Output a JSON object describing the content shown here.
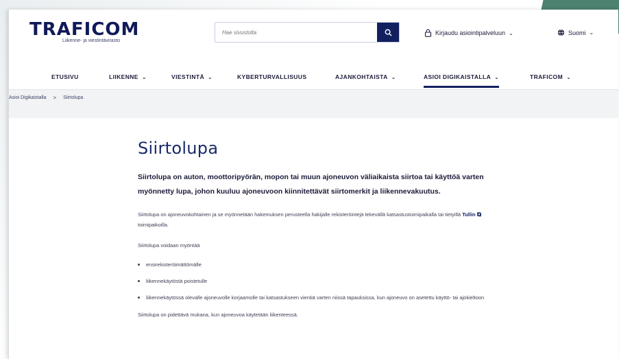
{
  "logo": {
    "wordmark": "TRAFICOM",
    "subtitle": "Liikenne- ja viestintävirasto"
  },
  "search": {
    "placeholder": "Hae sivustolta"
  },
  "header": {
    "login_label": "Kirjaudu asiointipalveluun",
    "language_label": "Suomi"
  },
  "nav": {
    "items": [
      {
        "label": "ETUSIVU"
      },
      {
        "label": "LIIKENNE"
      },
      {
        "label": "VIESTINTÄ"
      },
      {
        "label": "KYBERTURVALLISUUS"
      },
      {
        "label": "AJANKOHTAISTA"
      },
      {
        "label": "ASIOI DIGIKAISTALLA"
      },
      {
        "label": "TRAFICOM"
      }
    ]
  },
  "breadcrumb": {
    "items": [
      "Asioi Digikaistalla",
      "Siirtolupa"
    ],
    "separator": ">"
  },
  "main": {
    "title": "Siirtolupa",
    "lead": "Siirtolupa on auton, moottoripyörän, mopon tai muun ajoneuvon väliaikaista siirtoa tai käyttöä varten myönnetty lupa, johon kuuluu ajoneuvoon kiinnitettävät siirtomerkit ja liikennevakuutus.",
    "para1_before": "Siirtolupa on ajoneuvokohtainen ja se myönnetään hakemuksen perusteella hakijalle rekisteröintejä tekevällä katsastustoimipaikalla tai tietyillä",
    "para1_link": "Tullin",
    "para1_after": "toimipaikoilla.",
    "para2": "Siirtolupa voidaan myöntää",
    "list": [
      "ensirekisteröimättömälle",
      "liikennekäytöstä poistetulle",
      "liikennekäytössä olevalle ajoneuvolle korjaamolle tai katsastukseen vientiä varten niissä tapauksissa, kun ajoneuvo on asetettu käyttö- tai ajokieltoon"
    ],
    "para3": "Siirtolupa on pidettävä mukana, kun ajoneuvoa käytetään liikenteessä."
  },
  "colors": {
    "brand_navy": "#13205f",
    "title_blue": "#1a2b6b"
  }
}
